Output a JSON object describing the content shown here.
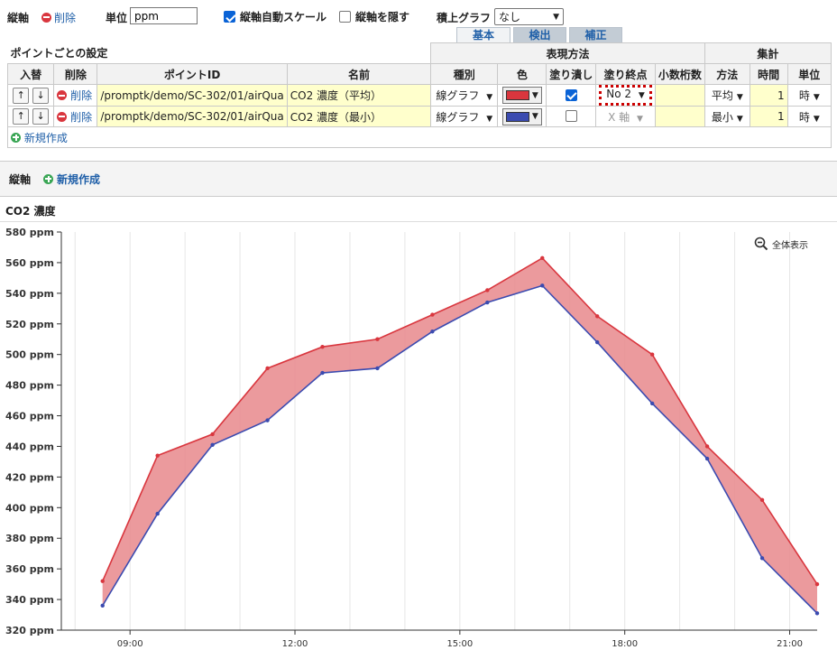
{
  "toolbar": {
    "axis_label": "縦軸",
    "delete_label": "削除",
    "unit_label": "単位",
    "unit_value": "ppm",
    "auto_scale_label": "縦軸自動スケール",
    "auto_scale_checked": true,
    "hide_axis_label": "縦軸を隠す",
    "hide_axis_checked": false,
    "stack_label": "積上グラフ",
    "stack_value": "なし"
  },
  "tabs": [
    {
      "label": "基本",
      "active": true
    },
    {
      "label": "検出",
      "active": false
    },
    {
      "label": "補正",
      "active": false
    }
  ],
  "point_settings": {
    "title": "ポイントごとの設定",
    "group_display": "表現方法",
    "group_agg": "集計",
    "columns": [
      "入替",
      "削除",
      "ポイントID",
      "名前",
      "種別",
      "色",
      "塗り潰し",
      "塗り終点",
      "小数桁数",
      "方法",
      "時間",
      "単位"
    ],
    "rows": [
      {
        "up": "↑",
        "down": "↓",
        "delete": "削除",
        "point_id": "/promptk/demo/SC-302/01/airQua",
        "name": "CO2 濃度（平均）",
        "type": "線グラフ",
        "color": "#d9363e",
        "fill": true,
        "fill_end": "No 2",
        "decimals": "",
        "method": "平均",
        "time": "1",
        "unit": "時"
      },
      {
        "up": "↑",
        "down": "↓",
        "delete": "削除",
        "point_id": "/promptk/demo/SC-302/01/airQua",
        "name": "CO2 濃度（最小）",
        "type": "線グラフ",
        "color": "#3b4bb0",
        "fill": false,
        "fill_end": "X 軸",
        "decimals": "",
        "method": "最小",
        "time": "1",
        "unit": "時"
      }
    ],
    "new_label": "新規作成"
  },
  "axis_section": {
    "label": "縦軸",
    "new_label": "新規作成"
  },
  "chart_section": {
    "title": "CO2 濃度",
    "fit_label": "全体表示"
  },
  "chart_data": {
    "type": "line",
    "title": "",
    "xlabel": "",
    "ylabel": "",
    "x_ticks": [
      "09:00",
      "12:00",
      "15:00",
      "18:00",
      "21:00"
    ],
    "x_tick_hours": [
      9,
      12,
      15,
      18,
      21
    ],
    "xlim": [
      7.75,
      21.5
    ],
    "ylim": [
      320,
      580
    ],
    "y_ticks": [
      320,
      340,
      360,
      380,
      400,
      420,
      440,
      460,
      480,
      500,
      520,
      540,
      560,
      580
    ],
    "y_unit": " ppm",
    "x_hours": [
      8.5,
      9.5,
      10.5,
      11.5,
      12.5,
      13.5,
      14.5,
      15.5,
      16.5,
      17.5,
      18.5,
      19.5,
      20.5,
      21.5
    ],
    "series": [
      {
        "name": "CO2 濃度（平均）",
        "color": "#d9363e",
        "values": [
          352,
          434,
          448,
          491,
          505,
          510,
          526,
          542,
          563,
          525,
          500,
          440,
          405,
          350
        ]
      },
      {
        "name": "CO2 濃度（最小）",
        "color": "#3b4bb0",
        "values": [
          336,
          396,
          441,
          457,
          488,
          491,
          515,
          534,
          545,
          508,
          468,
          432,
          367,
          331
        ]
      }
    ],
    "fill_between": [
      "CO2 濃度（平均）",
      "CO2 濃度（最小）"
    ],
    "fill_color": "#e8888c",
    "grid": "vertical"
  }
}
